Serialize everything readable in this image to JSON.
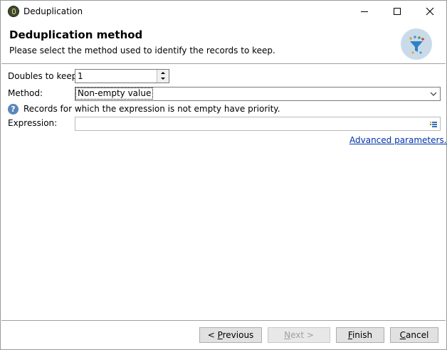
{
  "window": {
    "title": "Deduplication"
  },
  "header": {
    "title": "Deduplication method",
    "subtitle": "Please select the method used to identify the records to keep.",
    "icon": "funnel-filter-icon",
    "icon_bg": "#c9dbe8"
  },
  "form": {
    "doubles_label": "Doubles to keep:",
    "doubles_value": "1",
    "method_label": "Method:",
    "method_value": "Non-empty value",
    "info_text": "Records for which the expression is not empty have priority.",
    "expression_label": "Expression:",
    "expression_value": "",
    "advanced_link": "Advanced parameters..."
  },
  "footer": {
    "previous": {
      "prefix": "< ",
      "mnemonic": "P",
      "rest": "revious"
    },
    "next": {
      "mnemonic": "N",
      "rest": "ext >"
    },
    "finish": {
      "mnemonic": "F",
      "rest": "inish"
    },
    "cancel": {
      "mnemonic": "C",
      "rest": "ancel"
    }
  },
  "colors": {
    "link": "#0033aa",
    "info": "#5a86b9",
    "disabled_text": "#a0a0a0"
  }
}
